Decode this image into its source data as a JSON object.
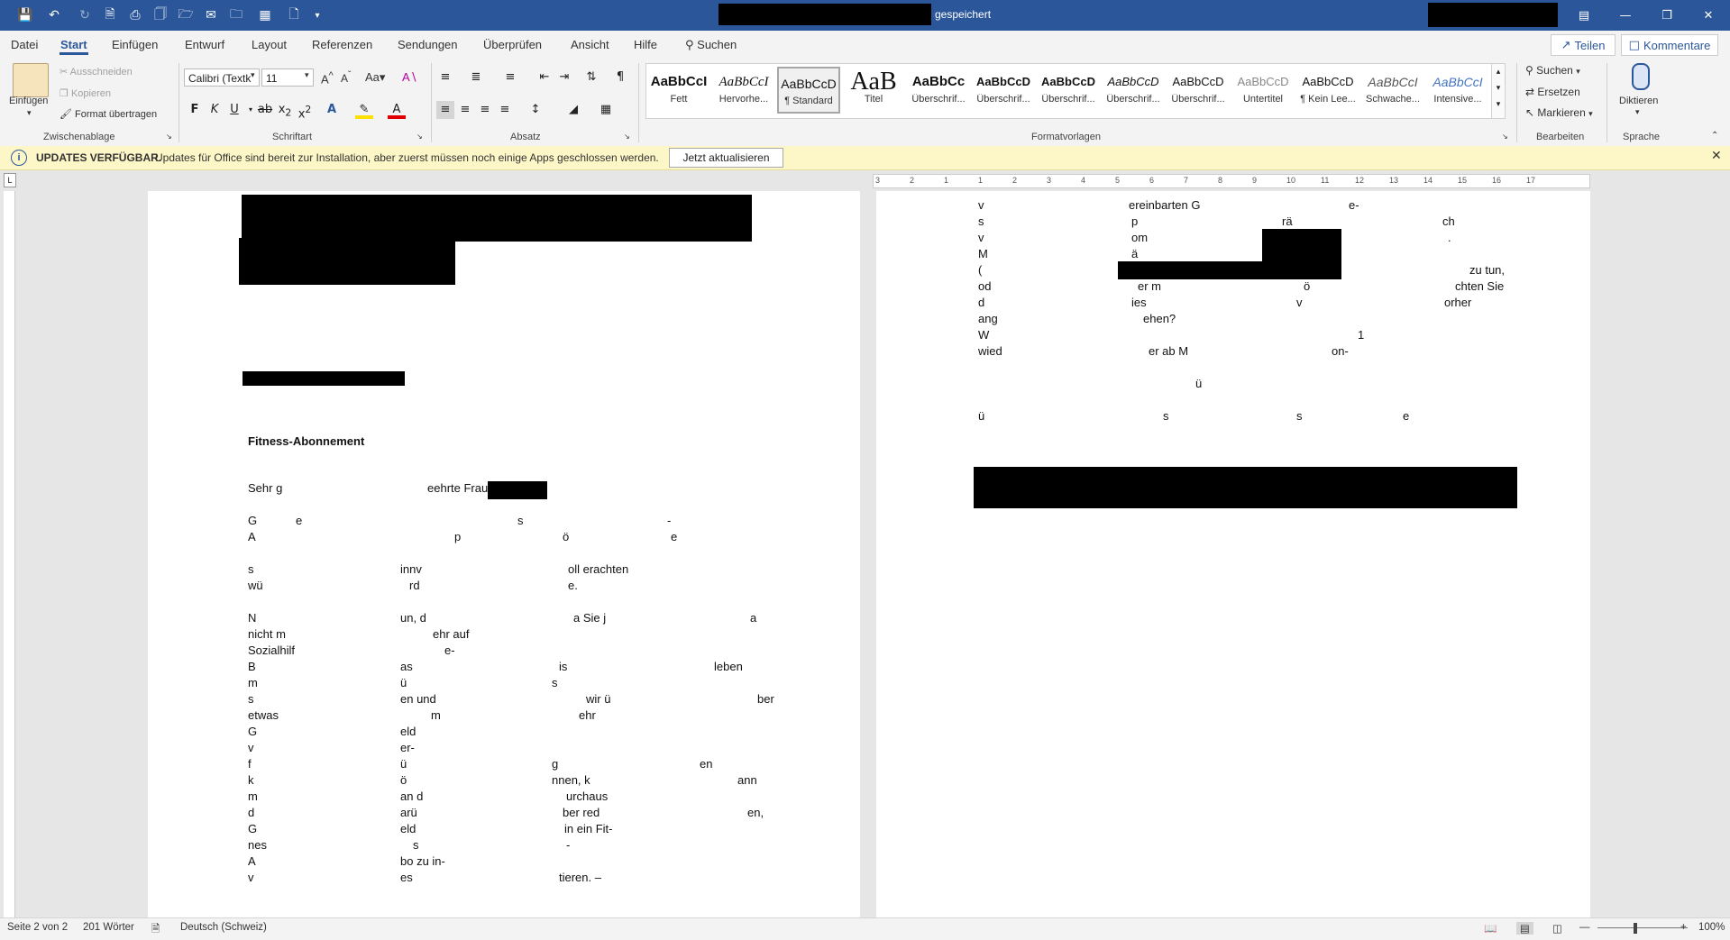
{
  "window": {
    "status": "gespeichert"
  },
  "menu": {
    "tabs": [
      "Datei",
      "Start",
      "Einfügen",
      "Entwurf",
      "Layout",
      "Referenzen",
      "Sendungen",
      "Überprüfen",
      "Ansicht",
      "Hilfe"
    ],
    "search_label": "Suchen",
    "share_label": "Teilen",
    "comments_label": "Kommentare"
  },
  "ribbon": {
    "clipboard": {
      "paste": "Einfügen",
      "cut": "Ausschneiden",
      "copy": "Kopieren",
      "format_painter": "Format übertragen",
      "label": "Zwischenablage"
    },
    "font": {
      "name": "Calibri (Textk",
      "size": "11",
      "label": "Schriftart"
    },
    "paragraph": {
      "label": "Absatz"
    },
    "styles": {
      "label": "Formatvorlagen",
      "items": [
        {
          "preview": "AaBbCcI",
          "name": "Fett"
        },
        {
          "preview": "AaBbCcI",
          "name": "Hervorhe..."
        },
        {
          "preview": "AaBbCcD",
          "name": "¶ Standard"
        },
        {
          "preview": "AaB",
          "name": "Titel"
        },
        {
          "preview": "AaBbCc",
          "name": "Überschrif..."
        },
        {
          "preview": "AaBbCcD",
          "name": "Überschrif..."
        },
        {
          "preview": "AaBbCcD",
          "name": "Überschrif..."
        },
        {
          "preview": "AaBbCcD",
          "name": "Überschrif..."
        },
        {
          "preview": "AaBbCcD",
          "name": "Überschrif..."
        },
        {
          "preview": "AaBbCcD",
          "name": "Untertitel"
        },
        {
          "preview": "AaBbCcD",
          "name": "¶ Kein Lee..."
        },
        {
          "preview": "AaBbCcI",
          "name": "Schwache..."
        },
        {
          "preview": "AaBbCcI",
          "name": "Intensive..."
        }
      ]
    },
    "editing": {
      "find": "Suchen",
      "replace": "Ersetzen",
      "select": "Markieren",
      "label": "Bearbeiten"
    },
    "voice": {
      "dictate": "Diktieren",
      "label": "Sprache"
    }
  },
  "update_bar": {
    "title": "UPDATES VERFÜGBAR.",
    "message": "Updates für Office sind bereit zur Installation, aber zuerst müssen noch einige Apps geschlossen werden.",
    "button": "Jetzt aktualisieren"
  },
  "ruler": {
    "ticks": [
      "3",
      "2",
      "1",
      "1",
      "2",
      "3",
      "4",
      "5",
      "6",
      "7",
      "8",
      "9",
      "10",
      "11",
      "12",
      "13",
      "14",
      "15",
      "16",
      "17"
    ]
  },
  "document": {
    "page1": {
      "subject": "Fitness-Abonnement",
      "lines": [
        {
          "t": [
            "Sehr g",
            "eehrte Frau"
          ]
        },
        {
          "t": [
            "G",
            "e",
            "s",
            "-"
          ]
        },
        {
          "t": [
            "A",
            "p",
            "ö",
            "e"
          ]
        },
        {
          "t": [
            "s",
            "innv",
            "oll erachten"
          ]
        },
        {
          "t": [
            "wü",
            "rd",
            "e."
          ]
        },
        {
          "t": [
            "N",
            "un, d",
            "a Sie j",
            "a"
          ]
        },
        {
          "t": [
            "nicht m",
            "ehr auf"
          ]
        },
        {
          "t": [
            "Sozialhilf",
            "e-"
          ]
        },
        {
          "t": [
            "B",
            "as",
            "is",
            "leben"
          ]
        },
        {
          "t": [
            "m",
            "ü",
            "s"
          ]
        },
        {
          "t": [
            "s",
            "en und",
            "wir ü",
            "ber"
          ]
        },
        {
          "t": [
            "etwas",
            "m",
            "ehr"
          ]
        },
        {
          "t": [
            "G",
            "eld"
          ]
        },
        {
          "t": [
            "v",
            "er-"
          ]
        },
        {
          "t": [
            "f",
            "ü",
            "g",
            "en"
          ]
        },
        {
          "t": [
            "k",
            "ö",
            "nnen, k",
            "ann"
          ]
        },
        {
          "t": [
            "m",
            "an d",
            "urchaus"
          ]
        },
        {
          "t": [
            "d",
            "arü",
            "ber red",
            "en,"
          ]
        },
        {
          "t": [
            "G",
            "eld",
            "in ein Fit-"
          ]
        },
        {
          "t": [
            "nes",
            "s",
            "-"
          ]
        },
        {
          "t": [
            "A",
            "bo zu in-"
          ]
        },
        {
          "t": [
            "v",
            "es",
            "tieren. –"
          ]
        }
      ]
    },
    "page2": {
      "lines": [
        {
          "t": [
            "v",
            "ereinbarten G",
            "e-"
          ]
        },
        {
          "t": [
            "s",
            "p",
            "rä",
            "ch"
          ]
        },
        {
          "t": [
            "v",
            "om",
            "."
          ]
        },
        {
          "t": [
            "M",
            "ä"
          ]
        },
        {
          "t": [
            "(",
            "zu tun,"
          ]
        },
        {
          "t": [
            "od",
            "er m",
            "ö",
            "chten Sie"
          ]
        },
        {
          "t": [
            "d",
            "ies",
            "v",
            "orher"
          ]
        },
        {
          "t": [
            "ang",
            "ehen?"
          ]
        },
        {
          "t": [
            "W",
            "1"
          ]
        },
        {
          "t": [
            "wied",
            "er ab M",
            "on-"
          ]
        },
        {
          "t": [
            "ü"
          ]
        },
        {
          "t": [
            "ü",
            "s",
            "s",
            "e"
          ]
        }
      ]
    }
  },
  "status_bar": {
    "page": "Seite 2 von 2",
    "words": "201 Wörter",
    "language": "Deutsch (Schweiz)",
    "zoom": "100%"
  }
}
